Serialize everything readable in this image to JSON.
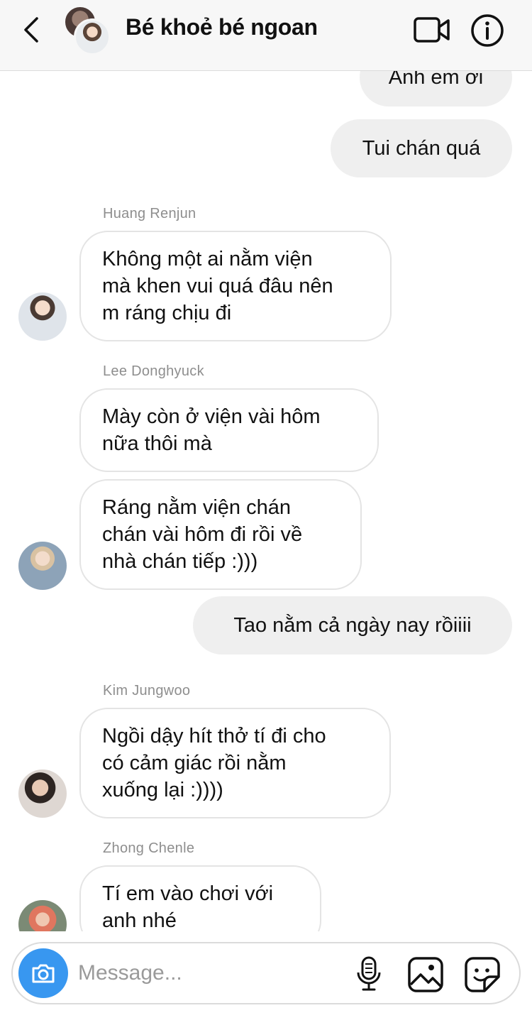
{
  "header": {
    "title": "Bé khoẻ bé ngoan",
    "icons": {
      "back": "chevron-left-icon",
      "video": "video-camera-icon",
      "info": "info-icon"
    }
  },
  "messages": [
    {
      "id": "m1",
      "direction": "outgoing",
      "text": "Anh em ơi"
    },
    {
      "id": "m2",
      "direction": "outgoing",
      "text": "Tui chán quá"
    },
    {
      "id": "m3",
      "direction": "incoming",
      "sender": "Huang Renjun",
      "lines": [
        "Không một ai nằm viện",
        "mà khen vui quá đâu nên",
        "m ráng chịu đi"
      ]
    },
    {
      "id": "m4",
      "direction": "incoming",
      "sender": "Lee Donghyuck",
      "lines": [
        "Mày còn ở viện vài hôm",
        "nữa thôi mà"
      ]
    },
    {
      "id": "m5",
      "direction": "incoming",
      "sender": "Lee Donghyuck",
      "lines": [
        "Ráng nằm viện chán",
        "chán vài hôm đi rồi về",
        "nhà chán tiếp :)))"
      ]
    },
    {
      "id": "m6",
      "direction": "outgoing",
      "text": "Tao nằm cả ngày nay rồiiii"
    },
    {
      "id": "m7",
      "direction": "incoming",
      "sender": "Kim Jungwoo",
      "lines": [
        "Ngồi dậy hít thở tí đi cho",
        "có cảm giác rồi nằm",
        "xuống lại :))))"
      ]
    },
    {
      "id": "m8",
      "direction": "incoming",
      "sender": "Zhong Chenle",
      "lines": [
        "Tí em vào chơi với",
        "anh nhé"
      ]
    }
  ],
  "composer": {
    "placeholder": "Message...",
    "value": "",
    "icons": {
      "camera": "camera-icon",
      "mic": "microphone-icon",
      "gallery": "gallery-icon",
      "sticker": "sticker-icon"
    }
  }
}
